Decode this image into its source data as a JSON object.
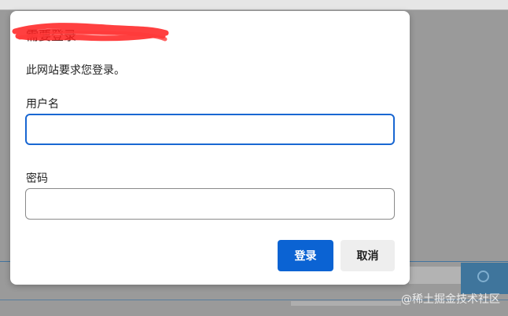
{
  "dialog": {
    "title": "需要登录",
    "message": "此网站要求您登录。",
    "username_label": "用户名",
    "username_value": "",
    "password_label": "密码",
    "password_value": "",
    "login_button": "登录",
    "cancel_button": "取消"
  },
  "watermark": "@稀土掘金技术社区",
  "colors": {
    "primary": "#0b63d3",
    "focus_border": "#1967d2",
    "overlay": "#9a9a9a",
    "redaction": "#ff1f1f"
  }
}
